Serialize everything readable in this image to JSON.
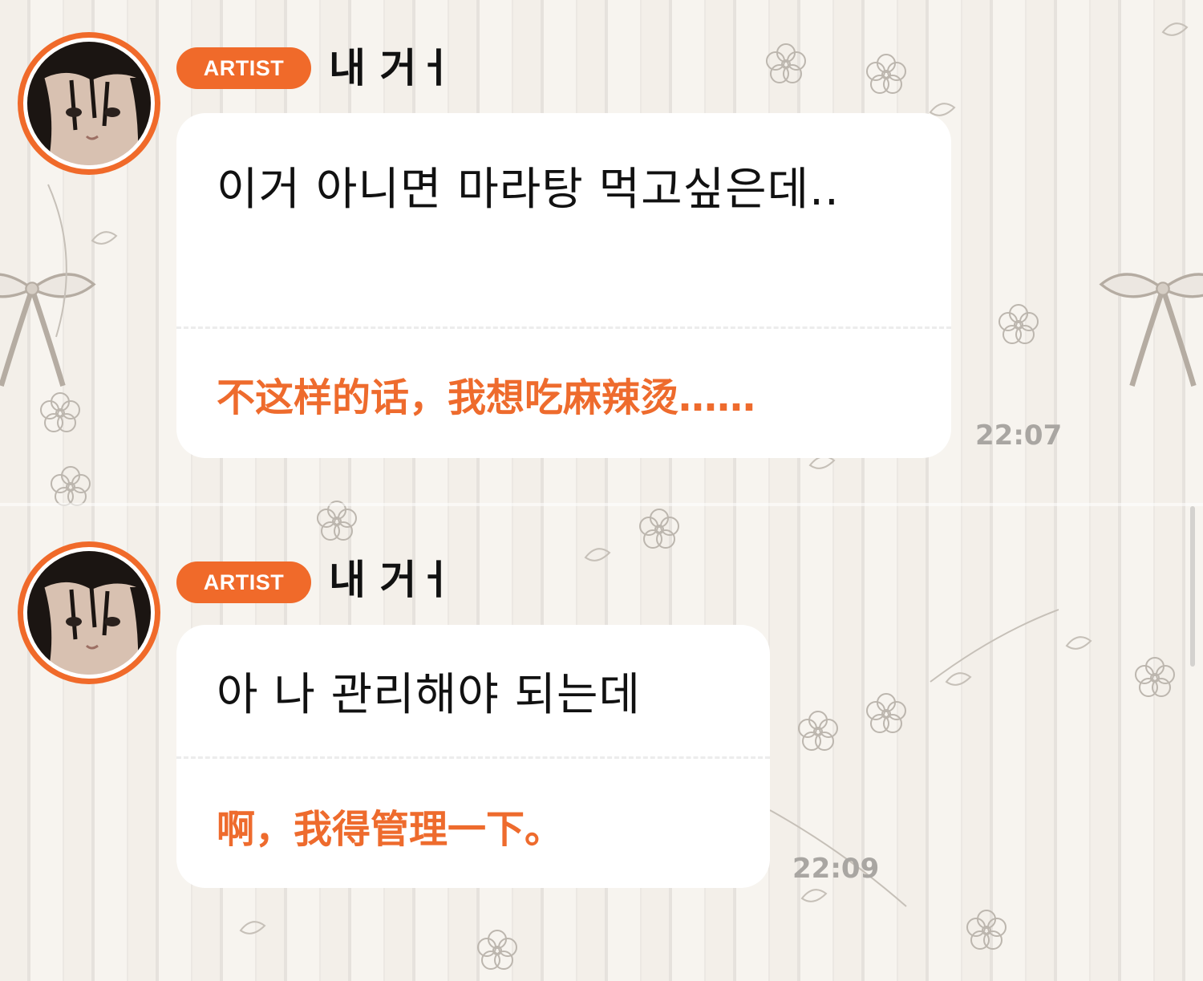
{
  "colors": {
    "accent": "#f06a2a",
    "translation_text": "#ee6b2d",
    "timestamp_text": "#a9a6a2",
    "bubble_bg": "#ffffff"
  },
  "messages": [
    {
      "badge": "ARTIST",
      "sender": "내 거ㅓ",
      "avatar_icon": "artist-avatar",
      "original": "이거 아니면 마라탕 먹고싶은데..",
      "translation": "不这样的话，我想吃麻辣烫……",
      "time": "22:07"
    },
    {
      "badge": "ARTIST",
      "sender": "내 거ㅓ",
      "avatar_icon": "artist-avatar",
      "original": "아 나 관리해야 되는데",
      "translation": "啊，我得管理一下。",
      "time": "22:09"
    }
  ]
}
